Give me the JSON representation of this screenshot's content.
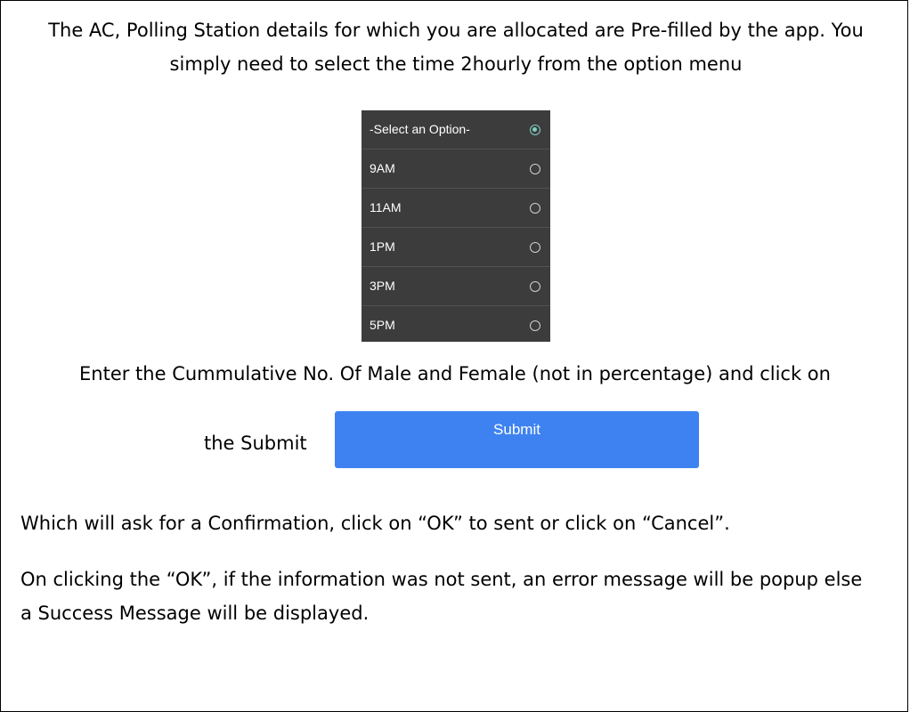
{
  "intro": "The AC, Polling Station details for which you are allocated are Pre-filled by the app. You simply need to select the time 2hourly  from the option menu",
  "option_menu": {
    "items": [
      {
        "label": "-Select an Option-",
        "selected": true
      },
      {
        "label": "9AM",
        "selected": false
      },
      {
        "label": "11AM",
        "selected": false
      },
      {
        "label": "1PM",
        "selected": false
      },
      {
        "label": "3PM",
        "selected": false
      },
      {
        "label": "5PM",
        "selected": false
      }
    ],
    "background_color": "#3c3c3c",
    "selected_radio_color": "#7fd0c0"
  },
  "enter_text": "Enter the Cummulative No. Of Male and Female (not in percentage) and click on",
  "submit_text": "the Submit",
  "submit_button": {
    "label": "Submit",
    "color": "#3d82f0"
  },
  "confirm_text": "Which will ask for a Confirmation, click on “OK” to sent or click on “Cancel”.",
  "result_text": "On clicking the “OK”, if the information was not sent, an error message will be popup else a Success Message will be displayed."
}
